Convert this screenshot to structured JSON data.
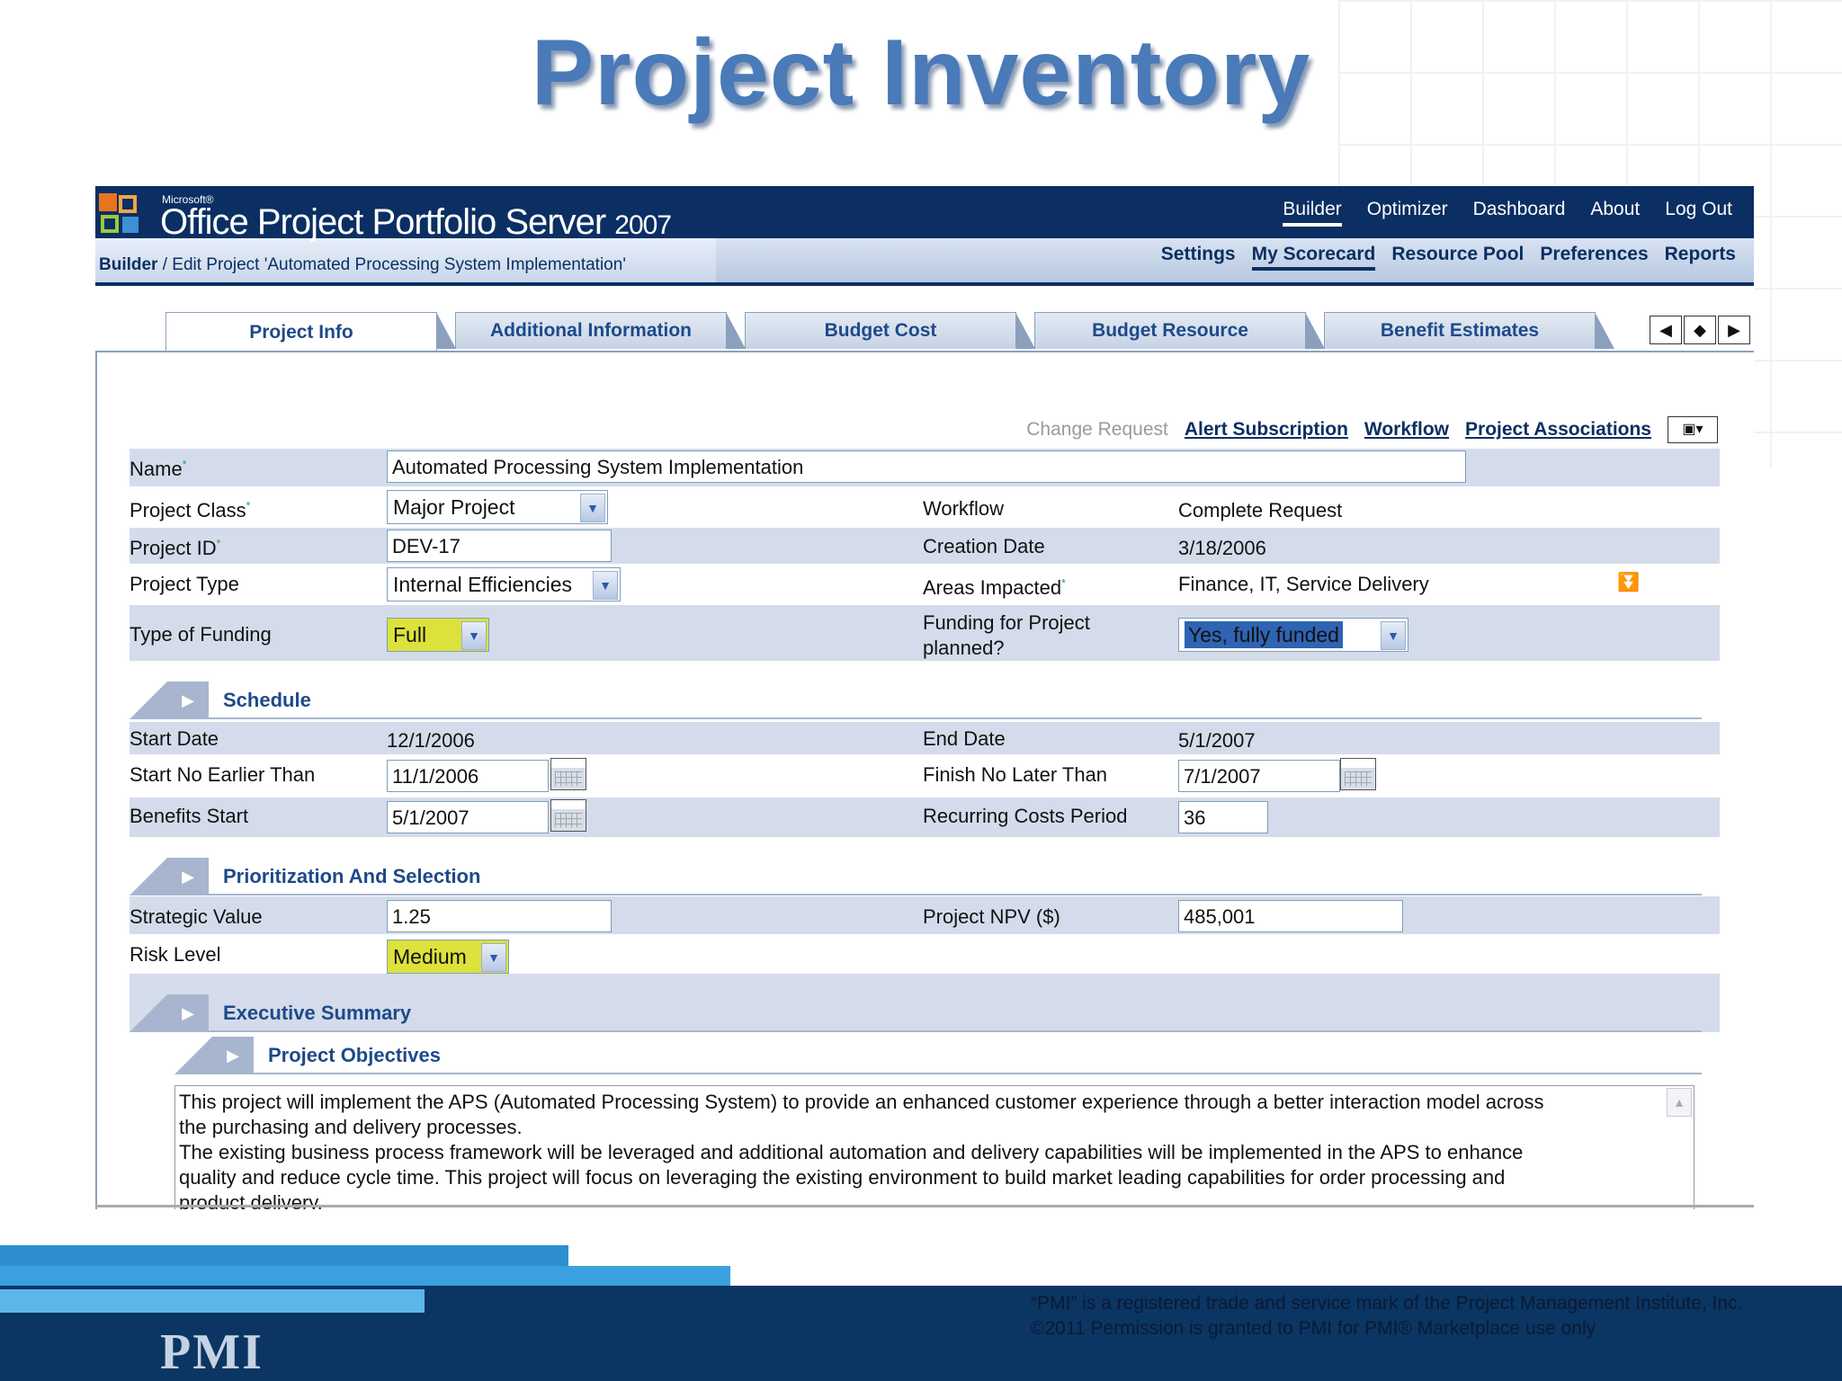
{
  "slide": {
    "title": "Project Inventory"
  },
  "app": {
    "brand_small": "Microsoft®",
    "brand": "Office Project Portfolio Server",
    "brand_year": "2007",
    "breadcrumb_root": "Builder",
    "breadcrumb_rest": " / Edit Project 'Automated Processing System Implementation'",
    "top_nav": [
      "Builder",
      "Optimizer",
      "Dashboard",
      "About",
      "Log Out"
    ],
    "top_nav_active": "Builder",
    "sub_nav": [
      "Settings",
      "My Scorecard",
      "Resource Pool",
      "Preferences",
      "Reports"
    ],
    "sub_nav_active": "My Scorecard",
    "tabs": [
      "Project Info",
      "Additional Information",
      "Budget Cost",
      "Budget Resource",
      "Benefit Estimates"
    ],
    "tab_active": "Project Info"
  },
  "actions": {
    "change_request": "Change Request",
    "alert_subscription": "Alert Subscription",
    "workflow": "Workflow",
    "project_associations": "Project Associations"
  },
  "form": {
    "name_label": "Name",
    "name_value": "Automated Processing System Implementation",
    "project_class_label": "Project Class",
    "project_class_value": "Major Project",
    "workflow_label": "Workflow",
    "workflow_value": "Complete Request",
    "project_id_label": "Project ID",
    "project_id_value": "DEV-17",
    "creation_date_label": "Creation Date",
    "creation_date_value": "3/18/2006",
    "project_type_label": "Project Type",
    "project_type_value": "Internal Efficiencies",
    "areas_impacted_label": "Areas Impacted",
    "areas_impacted_value": "Finance, IT, Service Delivery",
    "type_of_funding_label": "Type of Funding",
    "type_of_funding_value": "Full",
    "funding_planned_label_1": "Funding for Project",
    "funding_planned_label_2": "planned?",
    "funding_planned_value": "Yes, fully funded",
    "required_mark": "*"
  },
  "schedule": {
    "title": "Schedule",
    "start_date_label": "Start Date",
    "start_date_value": "12/1/2006",
    "end_date_label": "End Date",
    "end_date_value": "5/1/2007",
    "start_no_earlier_label": "Start No Earlier Than",
    "start_no_earlier_value": "11/1/2006",
    "finish_no_later_label": "Finish No Later Than",
    "finish_no_later_value": "7/1/2007",
    "benefits_start_label": "Benefits Start",
    "benefits_start_value": "5/1/2007",
    "recurring_costs_label": "Recurring Costs Period",
    "recurring_costs_value": "36"
  },
  "prioritization": {
    "title": "Prioritization And Selection",
    "strategic_value_label": "Strategic Value",
    "strategic_value_value": "1.25",
    "npv_label": "Project NPV ($)",
    "npv_value": "485,001",
    "risk_level_label": "Risk Level",
    "risk_level_value": "Medium"
  },
  "executive_summary": {
    "title": "Executive Summary",
    "objectives_title": "Project Objectives",
    "objectives_line1": "This project will implement the APS (Automated Processing System) to provide an enhanced customer experience through a better interaction model across",
    "objectives_line2": "the purchasing and delivery processes.",
    "objectives_line3": "The existing business process framework will be leveraged and additional automation and delivery capabilities will be implemented in the APS to enhance",
    "objectives_line4": "quality and reduce cycle time. This project will focus on leveraging the existing environment to build market leading capabilities for order processing and",
    "objectives_line5": "product delivery."
  },
  "footer": {
    "logo_text": "PMI",
    "legal_line1": "“PMI” is a registered trade and service mark of the Project Management Institute, Inc.",
    "legal_line2": "©2011 Permission is granted to PMI for PMI® Marketplace use only"
  },
  "colors": {
    "title_blue": "#4a7ab8",
    "header_navy": "#0b2f63",
    "row_shade": "#d4dceb",
    "highlight_yellow": "#dce23b",
    "highlight_blue": "#2f63b3"
  }
}
